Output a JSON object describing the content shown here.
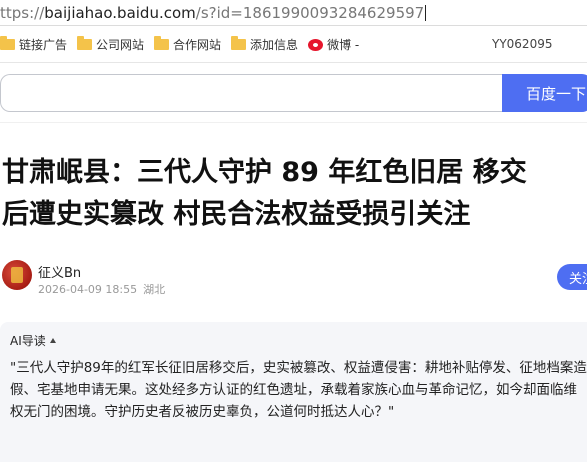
{
  "browser": {
    "url_prefix": "ttps://",
    "url_domain": "baijiahao.baidu.com",
    "url_path": "/s?id=1861990093284629597"
  },
  "bookmarks": {
    "items": [
      {
        "label": "链接广告",
        "icon": "folder-icon"
      },
      {
        "label": "公司网站",
        "icon": "folder-icon"
      },
      {
        "label": "合作网站",
        "icon": "folder-icon"
      },
      {
        "label": "添加信息",
        "icon": "folder-icon"
      },
      {
        "label": "微博 -",
        "icon": "weibo-icon"
      }
    ],
    "right_label": "YY062095"
  },
  "search": {
    "value": "",
    "button_label": "百度一下"
  },
  "article": {
    "title_line1": "甘肃岷县：三代人守护 89 年红色旧居 移交",
    "title_line2": "后遭史实篡改 村民合法权益受损引关注",
    "author": "征义Bn",
    "date": "2026-04-09 18:55",
    "location": "湖北",
    "follow_label": "关注"
  },
  "ai_summary": {
    "header": "AI导读",
    "text": "\"三代人守护89年的红军长征旧居移交后，史实被篡改、权益遭侵害：耕地补贴停发、征地档案造假、宅基地申请无果。这处经多方认证的红色遗址，承载着家族心血与革命记忆，如今却面临维权无门的困境。守护历史者反被历史辜负，公道何时抵达人心？\""
  },
  "colors": {
    "accent": "#4e6ef2",
    "folder": "#f4c34a",
    "weibo": "#e6162d",
    "summary_bg": "#f5f6f9"
  }
}
